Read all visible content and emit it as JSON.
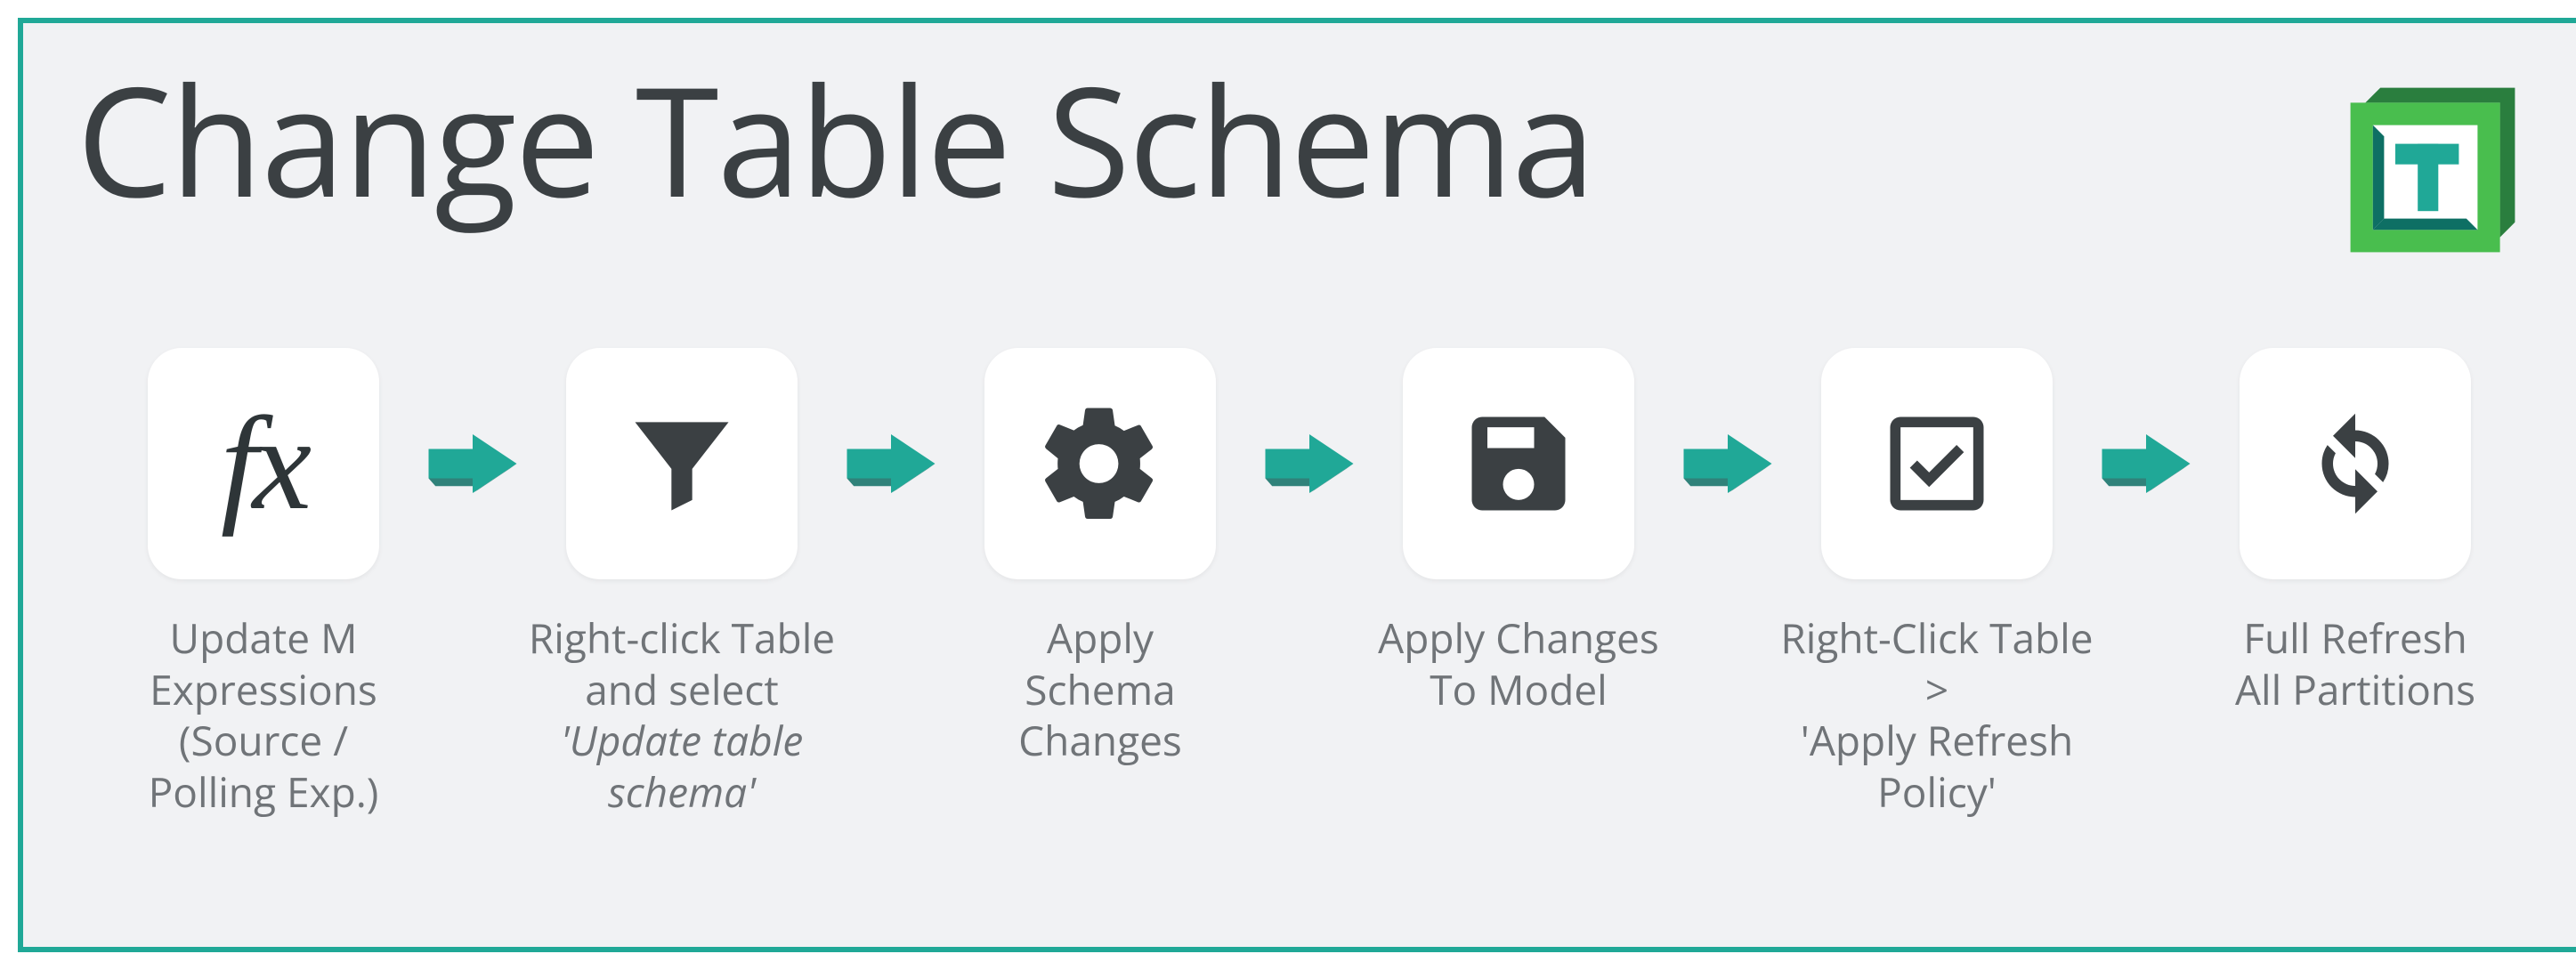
{
  "title": "Change Table Schema",
  "steps": [
    {
      "icon": "fx",
      "label_html": "Update M<br>Expressions<br>(Source /<br>Polling Exp.)"
    },
    {
      "icon": "funnel",
      "label_html": "Right-click Table<br>and select<br><em>'Update table<br>schema'</em>"
    },
    {
      "icon": "gear",
      "label_html": "Apply<br>Schema<br>Changes"
    },
    {
      "icon": "save",
      "label_html": "Apply Changes<br>To Model"
    },
    {
      "icon": "check",
      "label_html": "Right-Click Table ><br>'Apply Refresh Policy'"
    },
    {
      "icon": "refresh",
      "label_html": "Full Refresh<br>All Partitions"
    }
  ],
  "colors": {
    "teal": "#20A897",
    "tealDark": "#0E6F64",
    "green": "#49BE4E",
    "greenDark": "#2A7E3E",
    "iconDark": "#3B4043"
  }
}
